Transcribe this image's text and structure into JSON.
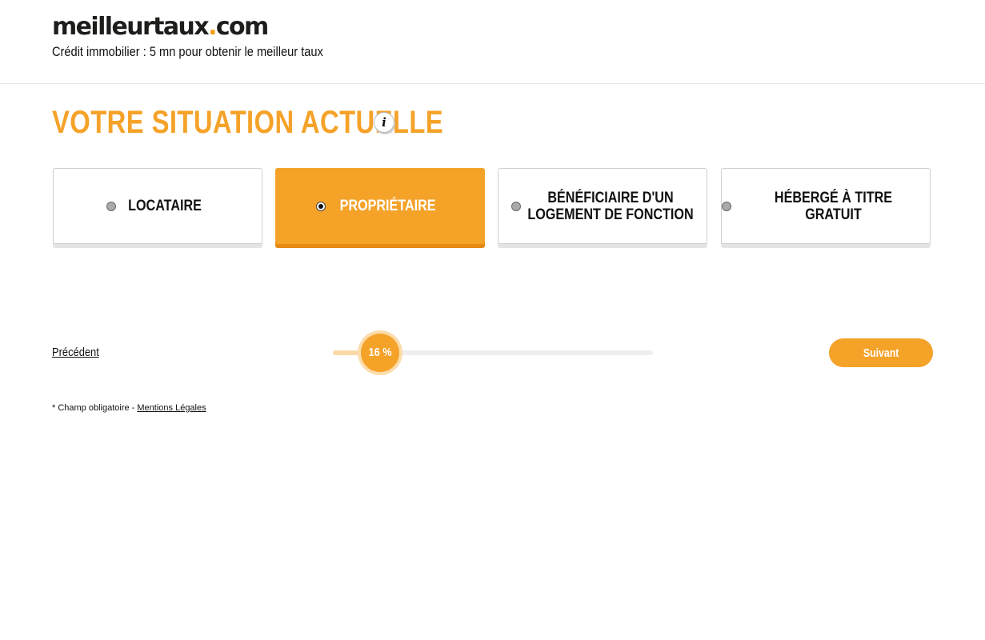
{
  "brand": {
    "logo_main": "meilleurtaux",
    "logo_dot": ".",
    "logo_tld": "com",
    "tagline": "Crédit immobilier : 5 mn pour obtenir le meilleur taux",
    "accent_color": "#f5a229"
  },
  "question": {
    "title": "VOTRE SITUATION ACTUELLE",
    "info_icon": "i",
    "options": [
      {
        "label": "LOCATAIRE",
        "selected": false
      },
      {
        "label": "PROPRIÉTAIRE",
        "selected": true
      },
      {
        "label": "BÉNÉFICIAIRE D'UN LOGEMENT DE FONCTION",
        "selected": false
      },
      {
        "label": "HÉBERGÉ À TITRE GRATUIT",
        "selected": false
      }
    ]
  },
  "navigation": {
    "prev_label": "Précédent",
    "next_label": "Suivant",
    "progress_text": "16 %",
    "progress_percent": 16
  },
  "footer": {
    "required_note": "* Champ obligatoire - ",
    "legal_link": "Mentions Légales"
  }
}
